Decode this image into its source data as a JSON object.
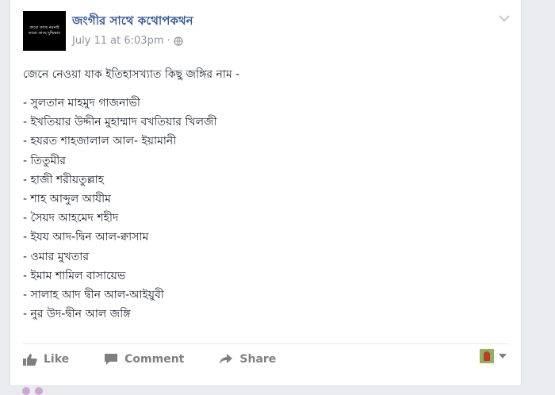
{
  "post": {
    "page_name": "জংগীর সাথে কথোপকথন",
    "timestamp": "July 11 at 6:03pm",
    "separator": "·",
    "avatar_lines": [
      "কারো কাছে নয়নাই",
      "কারো কাছে দুশ্চিন্তায়"
    ],
    "intro": "জেনে নেওয়া যাক ইতিহাসখ্যাত কিছু জঙ্গির নাম -",
    "names": [
      "- সুলতান মাহমুদ গাজনাভী",
      "- ইখতিয়ার উদ্দীন মুহাম্মাদ বখতিয়ার খিলজী",
      "- হযরত শাহজালাল আল- ইয়ামানী",
      "- তিতুমীর",
      "- হাজী শরীয়তুল্লাহ",
      "- শাহ আব্দুল আযীম",
      "- সৈয়দ আহমেদ শহীদ",
      "- ইযয আদ-দ্বিন আল-ক্বাসাম",
      "- ওমার মুখতার",
      "- ইমাম শামিল বাসায়েভ",
      "- সালাহ আদ দ্বীন আল-আইয়ুবী",
      "- নুর উদ-দ্বীন আল জঙ্গি"
    ]
  },
  "actions": {
    "like_label": "Like",
    "comment_label": "Comment",
    "share_label": "Share"
  },
  "colors": {
    "link": "#365899",
    "meta": "#90949c",
    "action": "#7f7f7f",
    "background": "#e9ebee"
  },
  "icons": [
    "globe-icon",
    "chevron-down-icon",
    "like-icon",
    "comment-icon",
    "share-icon",
    "caret-down-icon"
  ]
}
